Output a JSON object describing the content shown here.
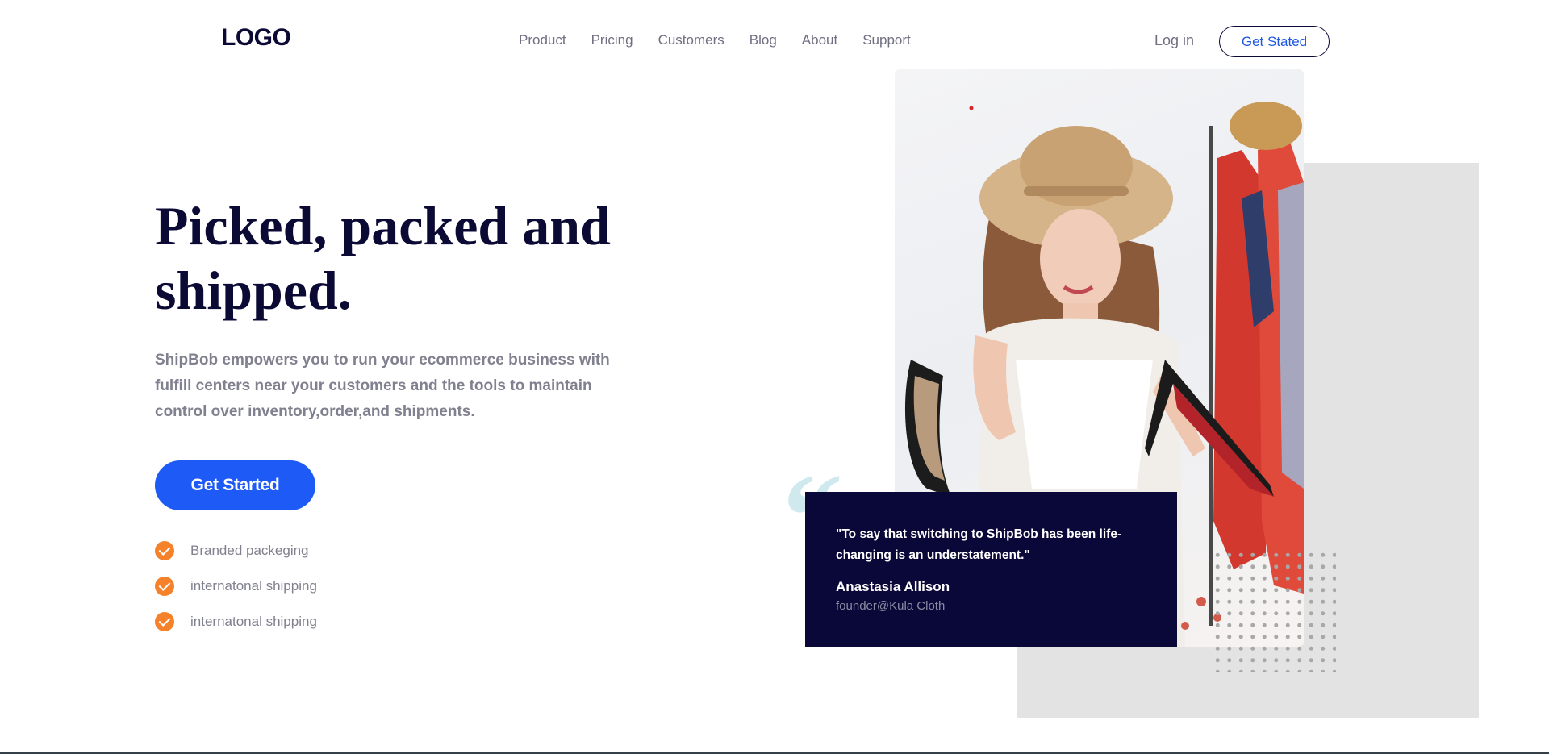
{
  "header": {
    "logo": "LOGO",
    "nav": [
      "Product",
      "Pricing",
      "Customers",
      "Blog",
      "About",
      "Support"
    ],
    "login": "Log in",
    "cta": "Get Stated"
  },
  "hero": {
    "headline": "Picked, packed and shipped.",
    "subtitle": "ShipBob empowers you to run your ecommerce business with fulfill centers near your customers and the tools to maintain control over inventory,order,and shipments.",
    "cta": "Get Started",
    "features": [
      "Branded packeging",
      "internatonal shipping",
      "internatonal shipping"
    ]
  },
  "testimonial": {
    "quote_mark": "“",
    "quote": "\"To say that switching to ShipBob has been life-changing is an understatement.\"",
    "name": "Anastasia Allison",
    "role": "founder@Kula Cloth"
  },
  "colors": {
    "navy": "#0b0a35",
    "primary_blue": "#1e5af5",
    "check_orange": "#f5822a",
    "quote_mark": "#cfe9ee",
    "panel_gray": "#e3e3e3"
  }
}
